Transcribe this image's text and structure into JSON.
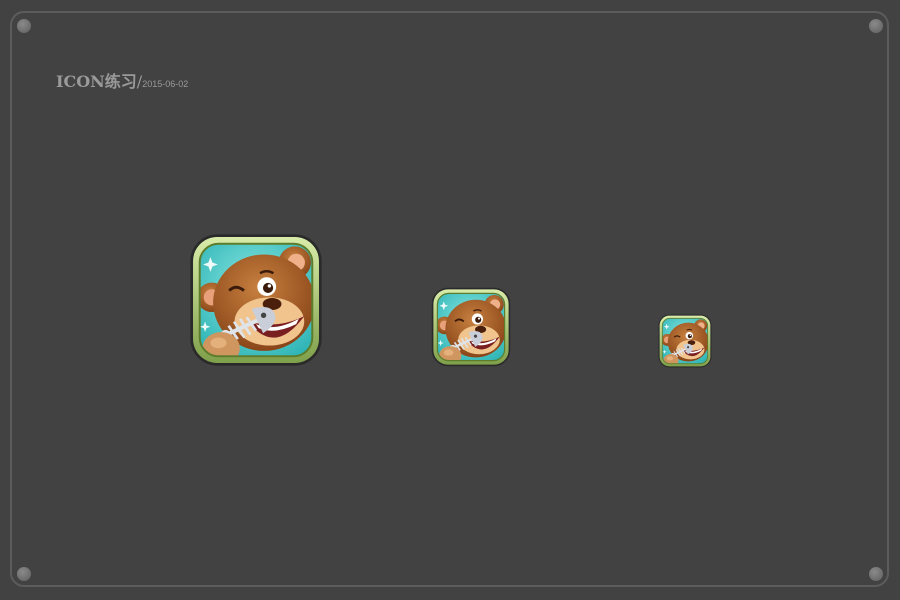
{
  "heading": {
    "title": "ICON练习",
    "separator": "/",
    "date": "2015-06-02"
  },
  "icons": [
    {
      "size": "large",
      "subject": "bear-holding-fish-bone-icon"
    },
    {
      "size": "medium",
      "subject": "bear-holding-fish-bone-icon"
    },
    {
      "size": "small",
      "subject": "bear-holding-fish-bone-icon"
    }
  ],
  "colors": {
    "background": "#424242",
    "frame": "#5c5c5c",
    "text": "#9a9a9a",
    "icon_border": "#a9c96f",
    "icon_sky": "#3fc7c4",
    "bear_fur": "#a65d2a"
  }
}
